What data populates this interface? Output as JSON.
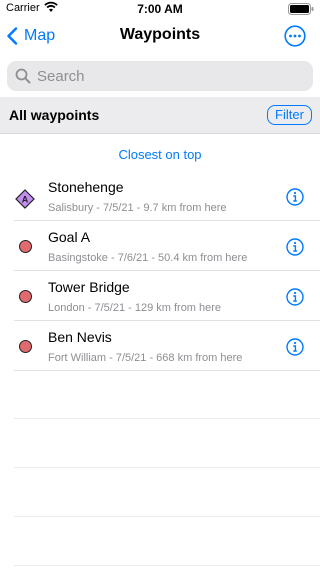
{
  "status_bar": {
    "carrier": "Carrier",
    "time": "7:00 AM"
  },
  "nav": {
    "back_label": "Map",
    "title": "Waypoints",
    "more_icon": "ellipsis-circle-icon"
  },
  "search": {
    "placeholder": "Search",
    "value": ""
  },
  "section": {
    "title": "All waypoints",
    "filter_label": "Filter"
  },
  "sort_label": "Closest on top",
  "waypoints": [
    {
      "name": "Stonehenge",
      "detail": "Salisbury - 7/5/21 - 9.7 km from here",
      "marker": "diamond",
      "marker_letter": "A"
    },
    {
      "name": "Goal A",
      "detail": "Basingstoke - 7/6/21 - 50.4 km from here",
      "marker": "circle"
    },
    {
      "name": "Tower Bridge",
      "detail": "London - 7/5/21 - 129 km from here",
      "marker": "circle"
    },
    {
      "name": "Ben Nevis",
      "detail": "Fort William - 7/5/21 - 668 km from here",
      "marker": "circle"
    }
  ],
  "colors": {
    "accent": "#007aff",
    "marker_red": "#e06a6e",
    "marker_purple": "#c48df0"
  }
}
